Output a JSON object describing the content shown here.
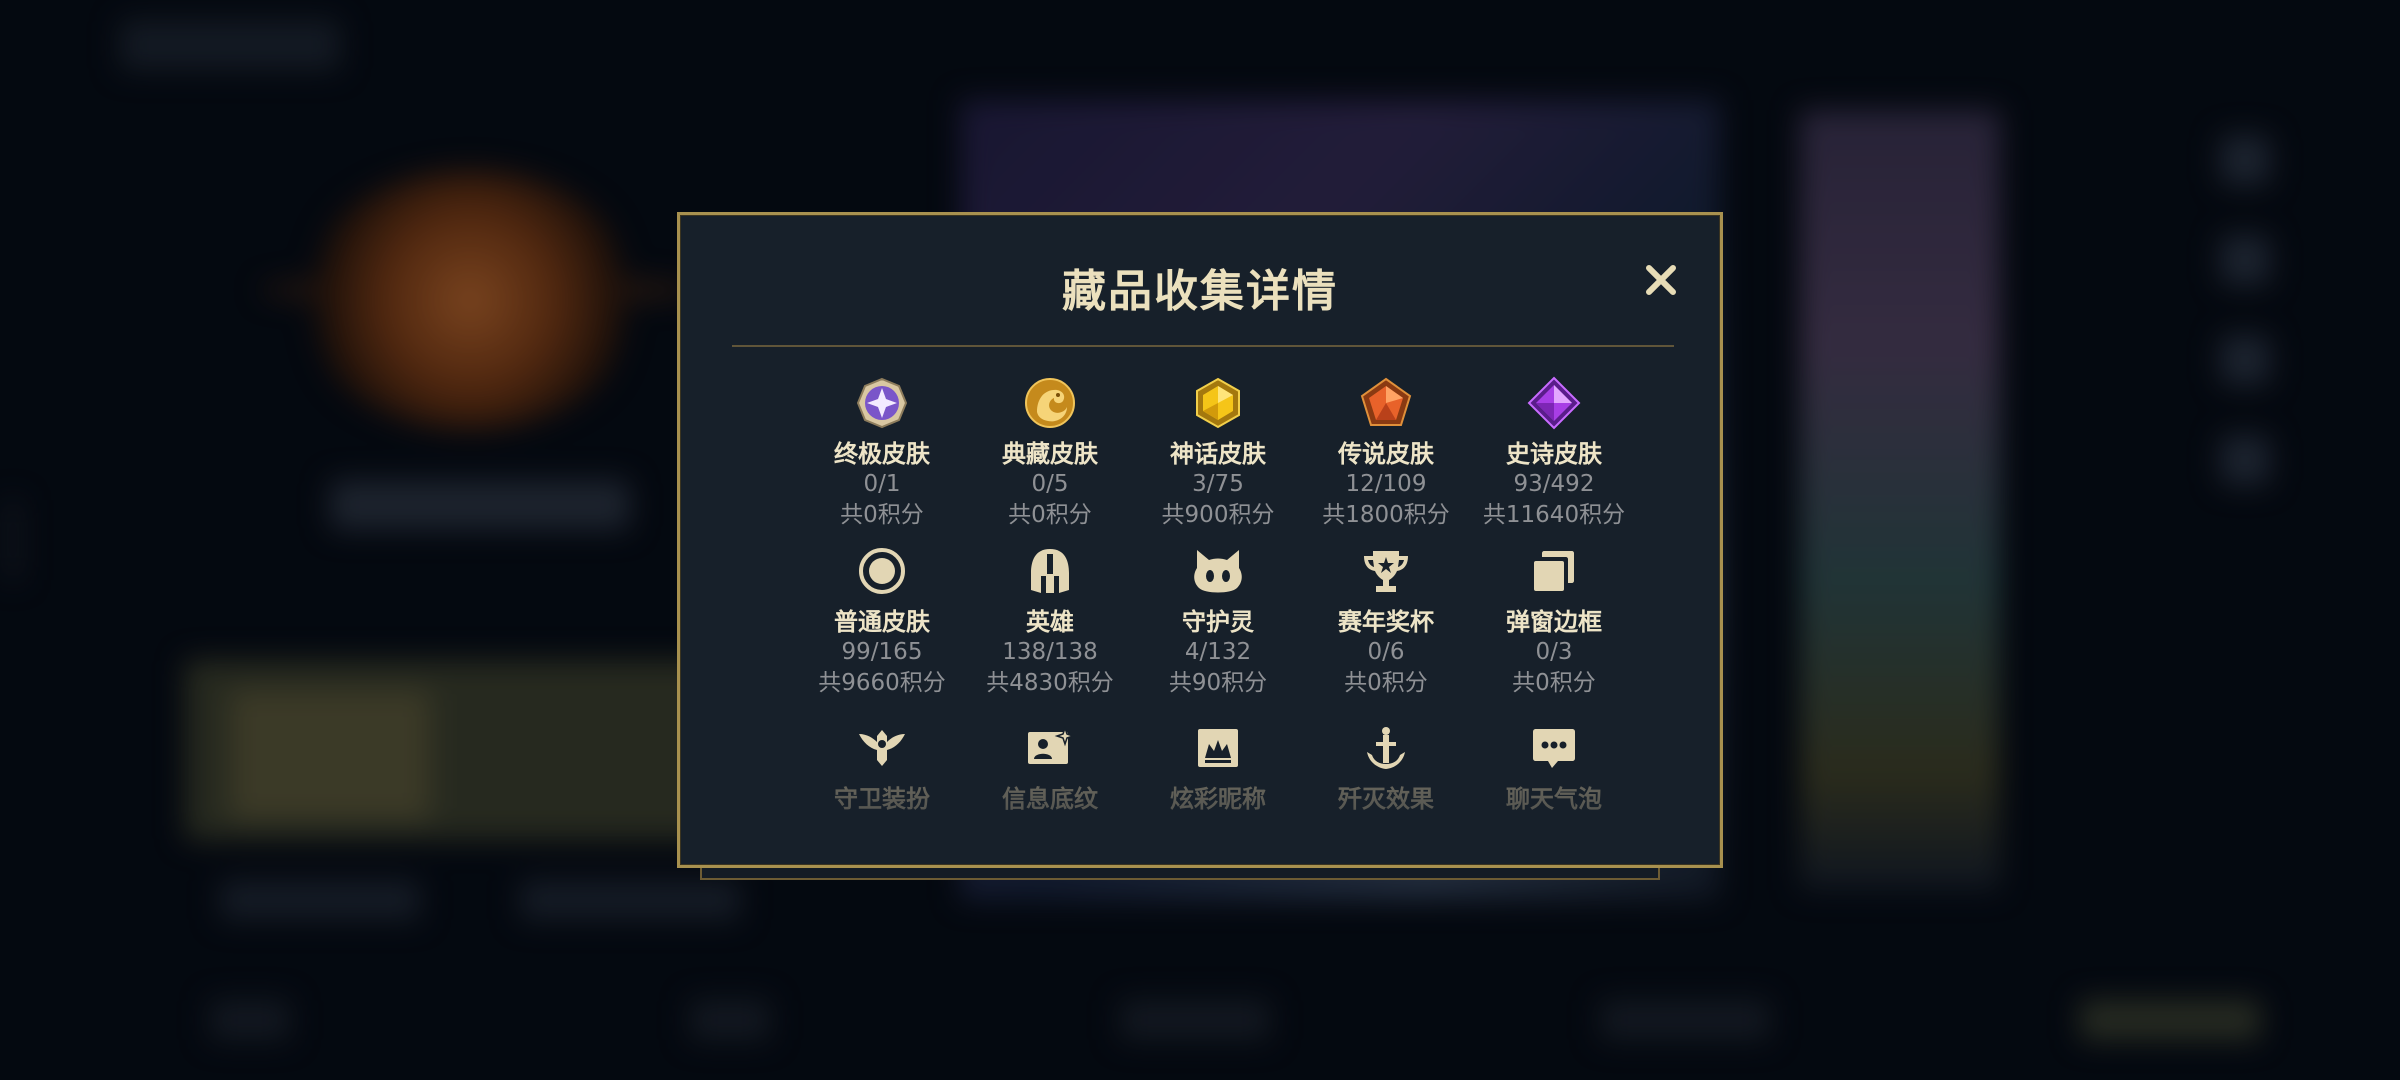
{
  "dialog": {
    "title": "藏品收集详情",
    "close_icon": "close-icon"
  },
  "colors": {
    "gold_border": "#a8914f",
    "title_text": "#ebe0bd",
    "muted_text": "#8f9195",
    "panel_bg": "#17202a"
  },
  "categories": [
    {
      "label": "终极皮肤",
      "count": "0/1",
      "points": "共0积分",
      "icon": "ultimate-skin-icon"
    },
    {
      "label": "典藏皮肤",
      "count": "0/5",
      "points": "共0积分",
      "icon": "prestige-skin-icon"
    },
    {
      "label": "神话皮肤",
      "count": "3/75",
      "points": "共900积分",
      "icon": "mythic-skin-icon"
    },
    {
      "label": "传说皮肤",
      "count": "12/109",
      "points": "共1800积分",
      "icon": "legendary-skin-icon"
    },
    {
      "label": "史诗皮肤",
      "count": "93/492",
      "points": "共11640积分",
      "icon": "epic-skin-icon"
    },
    {
      "label": "普通皮肤",
      "count": "99/165",
      "points": "共9660积分",
      "icon": "standard-skin-icon"
    },
    {
      "label": "英雄",
      "count": "138/138",
      "points": "共4830积分",
      "icon": "champion-helmet-icon"
    },
    {
      "label": "守护灵",
      "count": "4/132",
      "points": "共90积分",
      "icon": "guardian-icon"
    },
    {
      "label": "赛年奖杯",
      "count": "0/6",
      "points": "共0积分",
      "icon": "trophy-icon"
    },
    {
      "label": "弹窗边框",
      "count": "0/3",
      "points": "共0积分",
      "icon": "frame-icon"
    }
  ],
  "partial_row": [
    {
      "label": "守卫装扮",
      "icon": "ward-skin-icon"
    },
    {
      "label": "信息底纹",
      "icon": "profile-card-icon"
    },
    {
      "label": "炫彩昵称",
      "icon": "colored-name-icon"
    },
    {
      "label": "歼灭效果",
      "icon": "elimination-effect-icon"
    },
    {
      "label": "聊天气泡",
      "icon": "chat-bubble-icon"
    }
  ]
}
